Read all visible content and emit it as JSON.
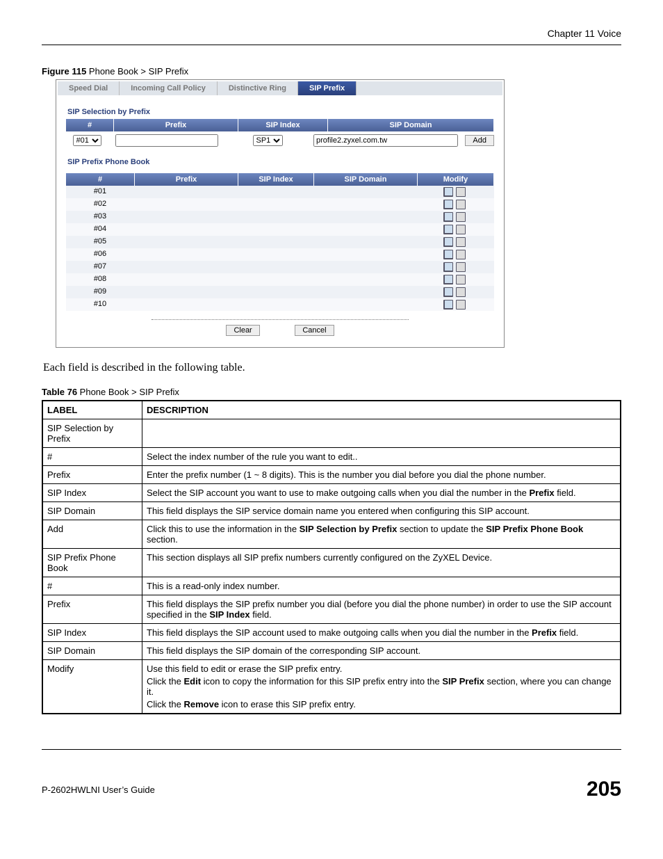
{
  "chapter": "Chapter 11 Voice",
  "figure_caption_label": "Figure 115",
  "figure_caption_text": "   Phone Book > SIP Prefix",
  "tabs": [
    "Speed Dial",
    "Incoming Call Policy",
    "Distinctive Ring",
    "SIP Prefix"
  ],
  "active_tab_index": 3,
  "section1_title": "SIP Selection by Prefix",
  "sel_headers": {
    "idx": "#",
    "prefix": "Prefix",
    "sipindex": "SIP Index",
    "sipdomain": "SIP Domain"
  },
  "index_select_value": "#01",
  "sipindex_select_value": "SP1",
  "sipdomain_value": "profile2.zyxel.com.tw",
  "add_button": "Add",
  "section2_title": "SIP Prefix Phone Book",
  "pb_headers": {
    "idx": "#",
    "prefix": "Prefix",
    "sipindex": "SIP Index",
    "sipdomain": "SIP Domain",
    "modify": "Modify"
  },
  "pb_rows": [
    {
      "idx": "#01"
    },
    {
      "idx": "#02"
    },
    {
      "idx": "#03"
    },
    {
      "idx": "#04"
    },
    {
      "idx": "#05"
    },
    {
      "idx": "#06"
    },
    {
      "idx": "#07"
    },
    {
      "idx": "#08"
    },
    {
      "idx": "#09"
    },
    {
      "idx": "#10"
    }
  ],
  "clear_button": "Clear",
  "cancel_button": "Cancel",
  "paragraph": "Each field is described in the following table.",
  "table_caption_label": "Table 76",
  "table_caption_text": "   Phone Book > SIP Prefix",
  "table_header_label": "LABEL",
  "table_header_desc": "DESCRIPTION",
  "desc_table": [
    {
      "label": "SIP Selection by Prefix",
      "desc": ""
    },
    {
      "label": "#",
      "desc": "Select the index number of the rule you want to edit.."
    },
    {
      "label": "Prefix",
      "desc": "Enter the prefix number (1 ~ 8 digits). This is the number you dial before you dial the phone number."
    },
    {
      "label": "SIP Index",
      "desc_parts": [
        "Select the SIP account you want to use to make outgoing calls when you dial the number in the ",
        "Prefix",
        " field."
      ]
    },
    {
      "label": "SIP Domain",
      "desc": "This field displays the SIP service domain name you entered when configuring this SIP account."
    },
    {
      "label": "Add",
      "desc_parts": [
        "Click this to use the information in the ",
        "SIP Selection by Prefix",
        " section to update the ",
        "SIP Prefix Phone Book",
        " section."
      ]
    },
    {
      "label": "SIP Prefix Phone Book",
      "desc": "This section displays all SIP prefix numbers currently configured on the ZyXEL Device."
    },
    {
      "label": "#",
      "desc": "This is a read-only index number."
    },
    {
      "label": "Prefix",
      "desc_parts": [
        "This field displays the SIP prefix number you dial (before you dial the phone number) in order to use the SIP account specified in the ",
        "SIP Index",
        " field."
      ]
    },
    {
      "label": "SIP Index",
      "desc_parts": [
        "This field displays the SIP account used to make outgoing calls when you dial the number in the ",
        "Prefix",
        " field."
      ]
    },
    {
      "label": "SIP Domain",
      "desc": "This field displays the SIP domain of the corresponding SIP account."
    },
    {
      "label": "Modify",
      "desc_multi": [
        {
          "t": "plain",
          "v": "Use this field to edit or erase the SIP prefix entry."
        },
        {
          "t": "parts",
          "v": [
            "Click the ",
            "Edit",
            " icon to copy the information for this SIP prefix entry into the ",
            "SIP Prefix",
            " section, where you can change it."
          ]
        },
        {
          "t": "parts",
          "v": [
            "Click the ",
            "Remove",
            " icon to erase this SIP prefix entry."
          ]
        }
      ]
    }
  ],
  "footer_guide": "P-2602HWLNI User’s Guide",
  "page_number": "205"
}
